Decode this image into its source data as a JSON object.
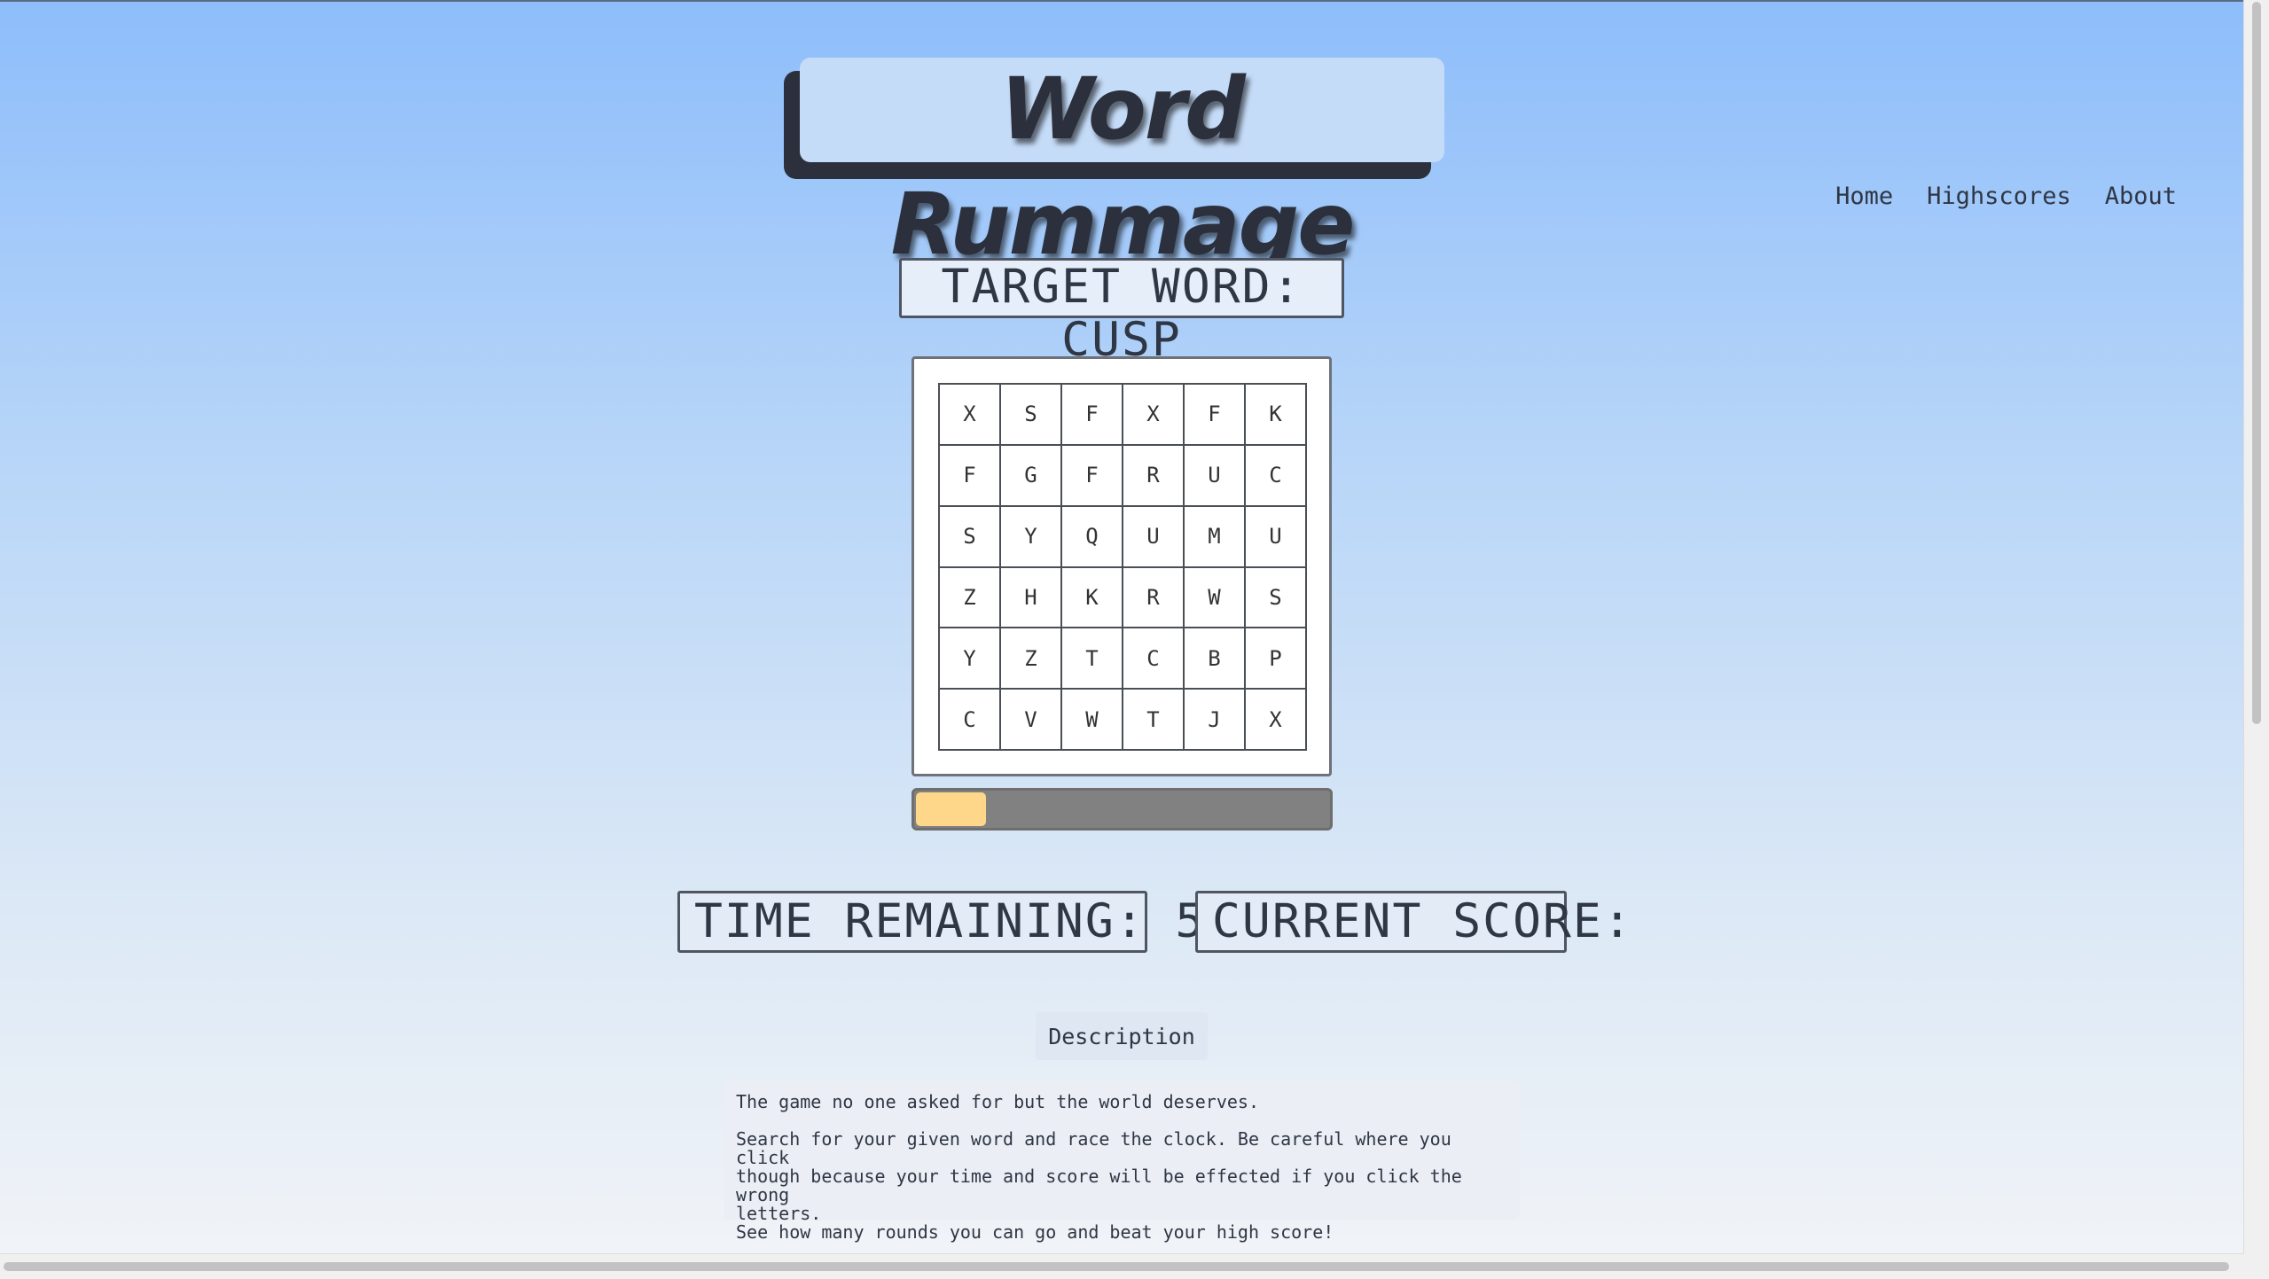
{
  "title": "Word Rummage",
  "nav": {
    "home": "Home",
    "highscores": "Highscores",
    "about": "About"
  },
  "target": {
    "label": "TARGET WORD: CUSP"
  },
  "grid": {
    "rows": [
      [
        "X",
        "S",
        "F",
        "X",
        "F",
        "K"
      ],
      [
        "F",
        "G",
        "F",
        "R",
        "U",
        "C"
      ],
      [
        "S",
        "Y",
        "Q",
        "U",
        "M",
        "U"
      ],
      [
        "Z",
        "H",
        "K",
        "R",
        "W",
        "S"
      ],
      [
        "Y",
        "Z",
        "T",
        "C",
        "B",
        "P"
      ],
      [
        "C",
        "V",
        "W",
        "T",
        "J",
        "X"
      ]
    ]
  },
  "progress": {
    "fraction": 0.17,
    "fill_color": "#ffd78a",
    "track_color": "#818181"
  },
  "stats": {
    "time": "TIME REMAINING: 58",
    "score": "CURRENT SCORE:"
  },
  "description": {
    "button_label": "Description",
    "line1": "The game no one asked for but the world deserves.",
    "line2": "Search for your given word and race the clock. Be careful where you click\nthough because your time and score will be effected if you click the wrong\nletters.",
    "line3": "See how many rounds you can go and beat your high score!"
  },
  "colors": {
    "background_top": "#8dbdfb",
    "background_bottom": "#f2f4f7",
    "text": "#2f3644"
  }
}
